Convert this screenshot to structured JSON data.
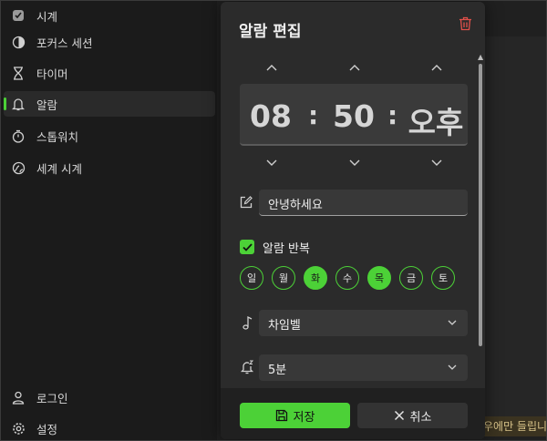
{
  "sidebar": {
    "items": [
      {
        "label": "시계",
        "icon": "clock-icon"
      },
      {
        "label": "포커스 세션",
        "icon": "focus-icon"
      },
      {
        "label": "타이머",
        "icon": "hourglass-icon"
      },
      {
        "label": "알람",
        "icon": "bell-icon",
        "active": true
      },
      {
        "label": "스톱워치",
        "icon": "stopwatch-icon"
      },
      {
        "label": "세계 시계",
        "icon": "globe-icon"
      }
    ],
    "bottom": [
      {
        "label": "로그인",
        "icon": "person-icon"
      },
      {
        "label": "설정",
        "icon": "gear-icon"
      }
    ]
  },
  "background": {
    "toast_text": "우에만 들립니다"
  },
  "dialog": {
    "title": "알람 편집",
    "time": {
      "hour": "08",
      "minute": "50",
      "separator": ":",
      "period": "오후"
    },
    "name_value": "안녕하세요",
    "repeat_label": "알람 반복",
    "repeat_checked": true,
    "days": [
      {
        "label": "일",
        "on": false
      },
      {
        "label": "월",
        "on": false
      },
      {
        "label": "화",
        "on": true
      },
      {
        "label": "수",
        "on": false
      },
      {
        "label": "목",
        "on": true
      },
      {
        "label": "금",
        "on": false
      },
      {
        "label": "토",
        "on": false
      }
    ],
    "sound_value": "차임벨",
    "snooze_value": "5분",
    "save_label": "저장",
    "cancel_label": "취소"
  },
  "colors": {
    "accent": "#4cd137",
    "delete": "#e0504a",
    "dialog_bg": "#2b2b2b"
  }
}
